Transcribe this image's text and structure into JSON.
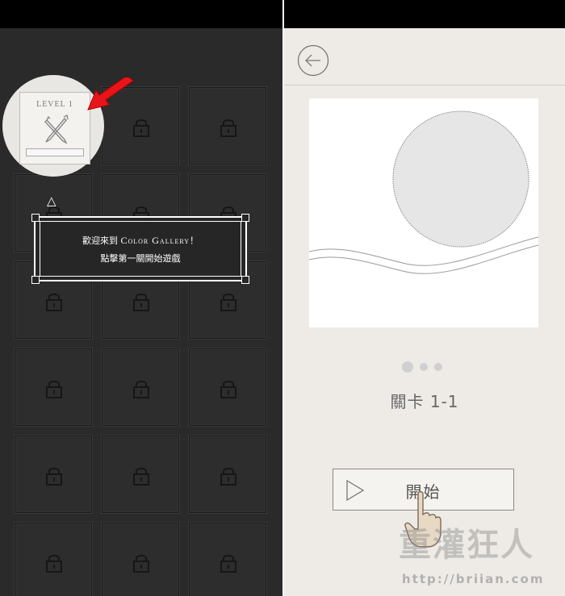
{
  "left_screen": {
    "level1": {
      "label": "LEVEL 1",
      "icon": "pencil-brush-icon"
    },
    "locked_icon": "lock-icon",
    "pointer_icon": "red-arrow-icon",
    "hint_icon": "triangle-icon",
    "dialog": {
      "line1_prefix": "歡迎來到 ",
      "line1_name": "Color Gallery",
      "line1_suffix": "！",
      "line2": "點擊第一關開始遊戲"
    }
  },
  "right_screen": {
    "back_icon": "back-arrow-icon",
    "stage_label": "關卡 1-1",
    "start_button_label": "開始",
    "play_icon": "play-icon",
    "pager": {
      "count": 3,
      "active": 1
    },
    "watermark": {
      "text": "重灌狂人",
      "url": "http://briian.com"
    }
  },
  "colors": {
    "left_bg": "#2a2a2a",
    "right_bg": "#eeebe6",
    "arrow": "#e8141a",
    "accent_text": "#666666"
  }
}
